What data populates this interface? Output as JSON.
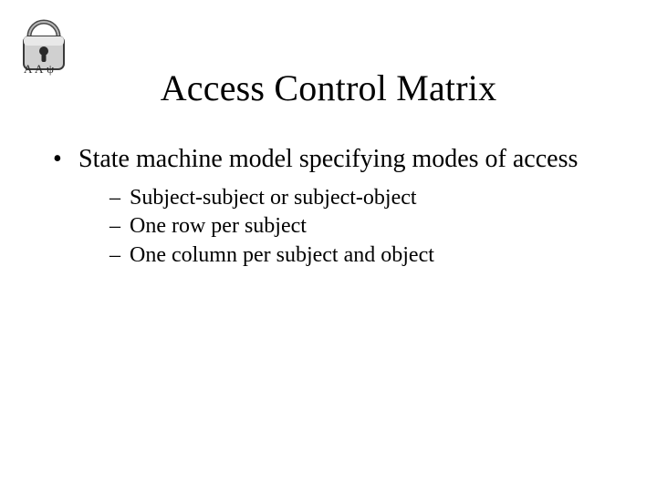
{
  "title": "Access Control Matrix",
  "bullets": [
    {
      "text": "State machine model specifying modes of access",
      "children": [
        "Subject-subject or subject-object",
        "One row per subject",
        "One column per subject and object"
      ]
    }
  ],
  "logo": {
    "alt": "padlock-logo"
  }
}
